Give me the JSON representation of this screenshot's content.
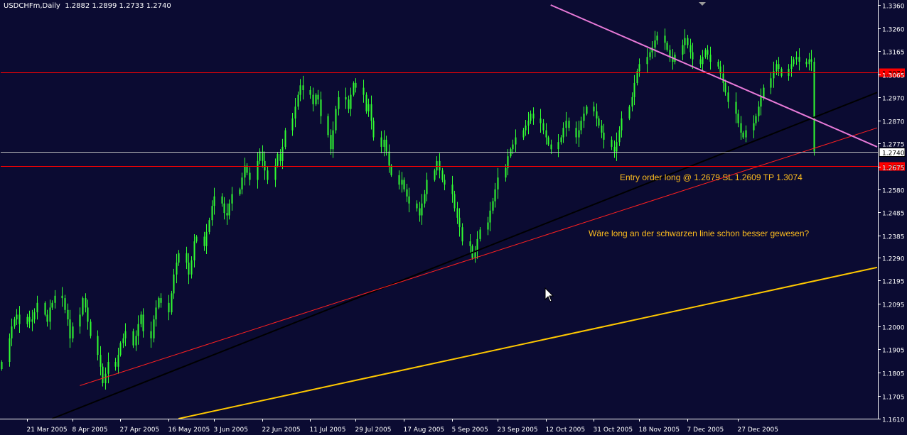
{
  "chart": {
    "symbol_info": "USDCHFm,Daily  1.2882 1.2899 1.2733 1.2740"
  },
  "annotations": {
    "entry_order": "Entry order long @ 1.2679 SL 1.2609 TP 1.3074",
    "note": "Wäre long an der schwarzen linie schon besser gewesen?"
  },
  "colors": {
    "background": "#0b0b32",
    "candle": "#32ff32",
    "axis": "#ffffff",
    "hline": "#ff0000",
    "trend_black": "#000000",
    "trend_red": "#ff2020",
    "trend_pink": "#e87ad8",
    "trend_yellow": "#ffc800",
    "price_line": "#c0c0c0",
    "annotation": "#ffbe1e"
  },
  "chart_data": {
    "type": "candlestick",
    "symbol": "USDCHFm",
    "timeframe": "Daily",
    "last_bar": {
      "open": 1.2882,
      "high": 1.2899,
      "low": 1.2733,
      "close": 1.274
    },
    "ylim": [
      1.161,
      1.336
    ],
    "y_ticks": [
      "1.3360",
      "1.3260",
      "1.3165",
      "1.3065",
      "1.2970",
      "1.2870",
      "1.2775",
      "1.2675",
      "1.2580",
      "1.2485",
      "1.2385",
      "1.2290",
      "1.2195",
      "1.2095",
      "1.2000",
      "1.1905",
      "1.1805",
      "1.1705",
      "1.1610"
    ],
    "x_ticks": [
      "21 Mar 2005",
      "8 Apr 2005",
      "27 Apr 2005",
      "16 May 2005",
      "3 Jun 2005",
      "22 Jun 2005",
      "11 Jul 2005",
      "29 Jul 2005",
      "17 Aug 2005",
      "5 Sep 2005",
      "23 Sep 2005",
      "12 Oct 2005",
      "31 Oct 2005",
      "18 Nov 2005",
      "7 Dec 2005",
      "27 Dec 2005"
    ],
    "x_range": [
      "2005-03-11",
      "2006-02-20"
    ],
    "horizontal_lines": [
      {
        "name": "tp-line",
        "price": 1.3074,
        "label": "1.3074"
      },
      {
        "name": "entry-line",
        "price": 1.2679,
        "label": "1.2679"
      },
      {
        "name": "current-price-line",
        "price": 1.274,
        "label": "1.2740"
      }
    ],
    "trendlines": [
      {
        "name": "black-trendline",
        "from": [
          "2005-03-31",
          1.161
        ],
        "to": [
          "2006-02-20",
          1.299
        ]
      },
      {
        "name": "red-trendline",
        "from": [
          "2005-04-11",
          1.175
        ],
        "to": [
          "2006-02-20",
          1.284
        ]
      },
      {
        "name": "pink-trendline",
        "from": [
          "2005-10-14",
          1.336
        ],
        "to": [
          "2006-02-20",
          1.276
        ]
      },
      {
        "name": "yellow-trendline",
        "from": [
          "2005-05-20",
          1.161
        ],
        "to": [
          "2006-02-20",
          1.225
        ]
      }
    ],
    "series": [
      {
        "start": "2005-03-11",
        "weekdays_only": true,
        "close": [
          1.185,
          1.195,
          1.2,
          1.203,
          1.205,
          1.201,
          1.204,
          1.202,
          1.203,
          1.206,
          1.21,
          1.205,
          1.202,
          1.208,
          1.21,
          1.213,
          1.212,
          1.207,
          1.203,
          1.195,
          1.2,
          1.205,
          1.212,
          1.208,
          1.202,
          1.196,
          1.188,
          1.183,
          1.176,
          1.18,
          1.185,
          1.183,
          1.188,
          1.193,
          1.195,
          1.198,
          1.192,
          1.196,
          1.201,
          1.205,
          1.198,
          1.195,
          1.203,
          1.208,
          1.212,
          1.21,
          1.206,
          1.214,
          1.222,
          1.227,
          1.231,
          1.227,
          1.222,
          1.228,
          1.236,
          1.238,
          1.234,
          1.24,
          1.245,
          1.251,
          1.255,
          1.252,
          1.248,
          1.247,
          1.252,
          1.256,
          1.258,
          1.263,
          1.268,
          1.265,
          1.262,
          1.27,
          1.274,
          1.27,
          1.266,
          1.262,
          1.268,
          1.273,
          1.27,
          1.276,
          1.283,
          1.288,
          1.293,
          1.298,
          1.302,
          1.3,
          1.298,
          1.294,
          1.298,
          1.296,
          1.289,
          1.281,
          1.275,
          1.283,
          1.292,
          1.297,
          1.296,
          1.292,
          1.298,
          1.303,
          1.301,
          1.298,
          1.291,
          1.294,
          1.287,
          1.28,
          1.276,
          1.279,
          1.274,
          1.268,
          1.264,
          1.26,
          1.262,
          1.258,
          1.255,
          1.252,
          1.25,
          1.247,
          1.252,
          1.256,
          1.262,
          1.266,
          1.27,
          1.266,
          1.262,
          1.26,
          1.256,
          1.25,
          1.246,
          1.242,
          1.236,
          1.234,
          1.229,
          1.232,
          1.237,
          1.241,
          1.244,
          1.249,
          1.253,
          1.258,
          1.263,
          1.267,
          1.272,
          1.275,
          1.277,
          1.28,
          1.283,
          1.285,
          1.287,
          1.29,
          1.288,
          1.286,
          1.283,
          1.28,
          1.277,
          1.275,
          1.278,
          1.28,
          1.284,
          1.287,
          1.284,
          1.28,
          1.283,
          1.287,
          1.29,
          1.293,
          1.291,
          1.288,
          1.285,
          1.282,
          1.279,
          1.276,
          1.274,
          1.278,
          1.283,
          1.288,
          1.293,
          1.297,
          1.303,
          1.308,
          1.311,
          1.314,
          1.316,
          1.318,
          1.321,
          1.323,
          1.32,
          1.317,
          1.314,
          1.312,
          1.315,
          1.319,
          1.322,
          1.319,
          1.316,
          1.313,
          1.311,
          1.314,
          1.317,
          1.315,
          1.312,
          1.31,
          1.307,
          1.303,
          1.299,
          1.295,
          1.29,
          1.286,
          1.282,
          1.28,
          1.283,
          1.286,
          1.289,
          1.293,
          1.297,
          1.301,
          1.305,
          1.308,
          1.311,
          1.309,
          1.306,
          1.309,
          1.311,
          1.313,
          1.314,
          1.312,
          1.311,
          1.313,
          1.312,
          1.274
        ],
        "color": "#32ff32"
      }
    ]
  }
}
